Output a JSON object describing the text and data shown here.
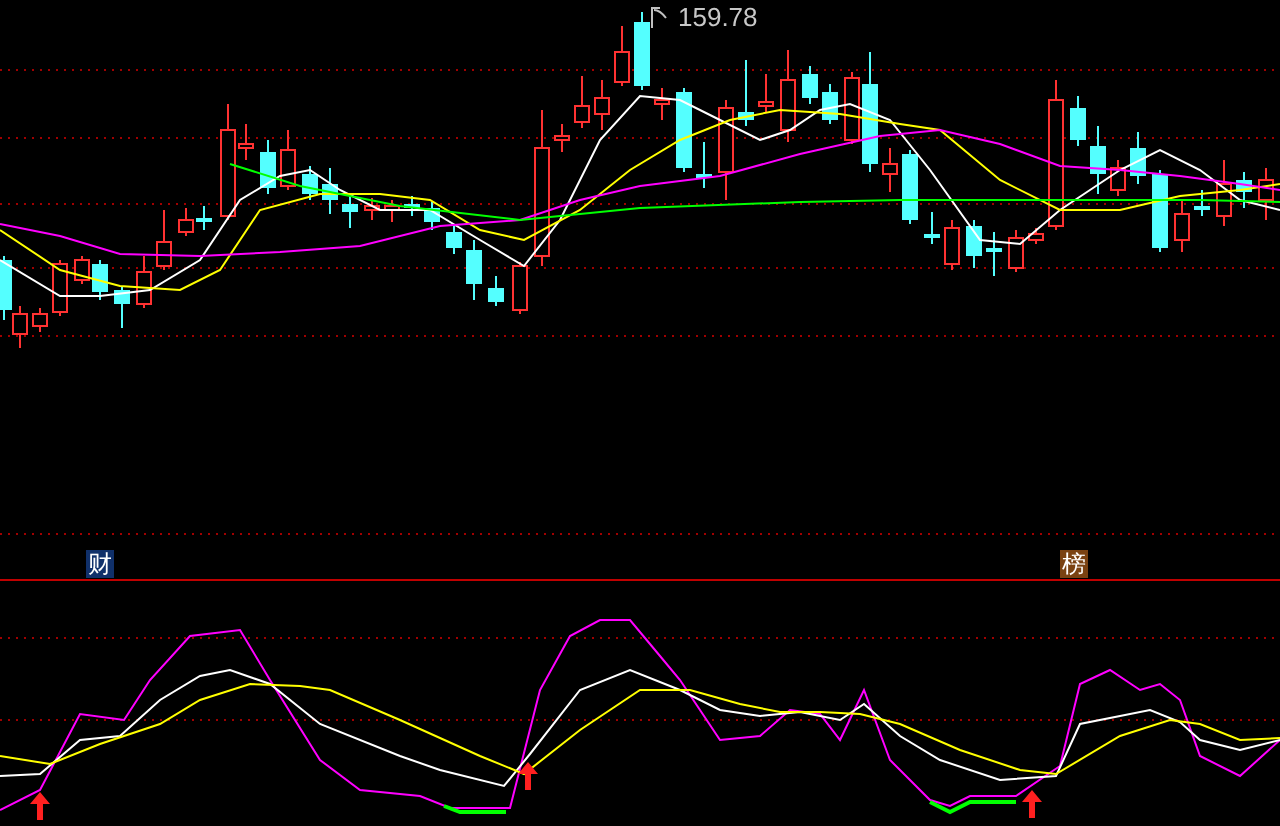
{
  "price_chart": {
    "high_label": "159.78"
  },
  "markers": [
    {
      "label": "财",
      "color": "#10306a"
    },
    {
      "label": "榜",
      "color": "#7a4212"
    }
  ]
}
